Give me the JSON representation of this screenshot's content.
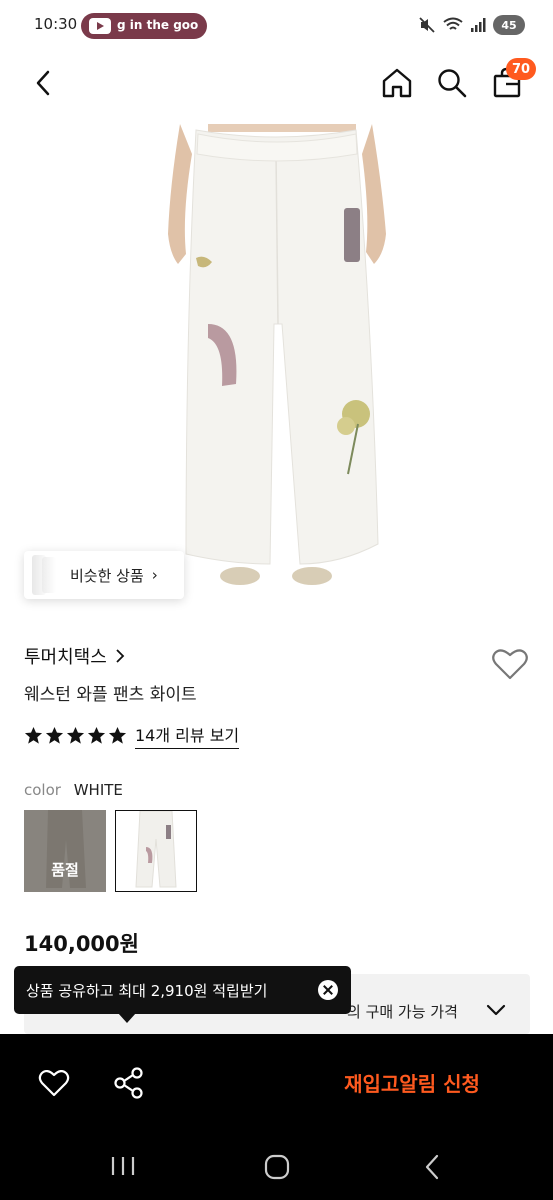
{
  "status_bar": {
    "time": "10:30",
    "media_text": "g in the goo",
    "battery": "45"
  },
  "header": {
    "cart_count": "70",
    "accent_color": "#ff5a1f"
  },
  "product": {
    "similar_label": "비슷한 상품",
    "brand": "투머치택스",
    "title": "웨스턴 와플 팬츠 화이트",
    "rating_stars": 5,
    "review_link": "14개 리뷰 보기",
    "color_label": "color",
    "color_value": "WHITE",
    "swatches": [
      {
        "status": "품절"
      },
      {
        "status": ""
      }
    ],
    "price": "140,000원",
    "member_price_text": "의 구매 가능 가격"
  },
  "tooltip": {
    "text": "상품 공유하고 최대 2,910원 적립받기"
  },
  "action_bar": {
    "restock_label": "재입고알림 신청"
  },
  "icons": [
    "back-icon",
    "home-icon",
    "search-icon",
    "bag-icon",
    "heart-icon",
    "share-icon",
    "star-icon",
    "close-icon",
    "chevron-down-icon"
  ]
}
